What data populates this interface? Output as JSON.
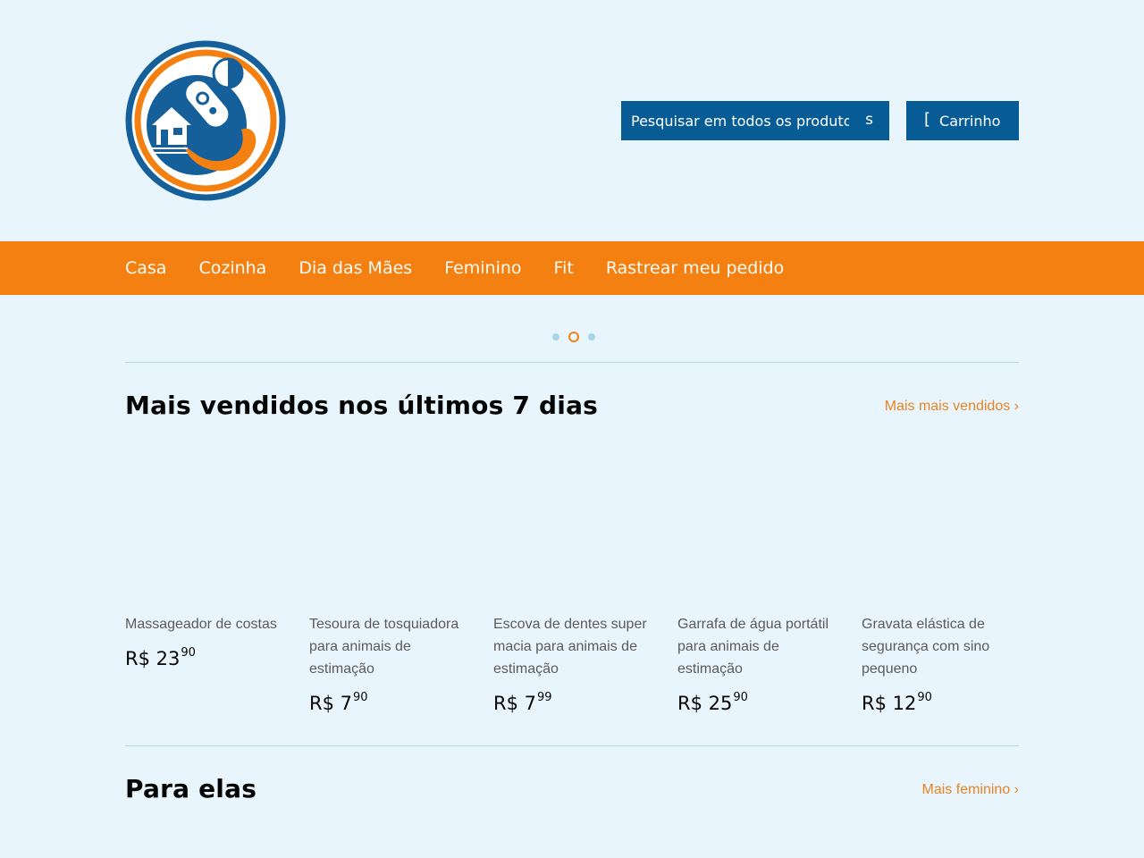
{
  "header": {
    "logo": "rocket-house-logo",
    "search": {
      "placeholder": "Pesquisar em todos os produtos",
      "icon_label": "s"
    },
    "cart": {
      "icon_label": "[",
      "label": "Carrinho"
    }
  },
  "nav": {
    "items": [
      "Casa",
      "Cozinha",
      "Dia das Mães",
      "Feminino",
      "Fit",
      "Rastrear meu pedido"
    ]
  },
  "slideshow": {
    "dots": 3,
    "active_index": 1
  },
  "bestsellers": {
    "title": "Mais vendidos nos últimos 7 dias",
    "link": "Mais mais vendidos ›",
    "products": [
      {
        "name": "Massageador de costas",
        "price": "R$ 23",
        "cents": "90"
      },
      {
        "name": "Tesoura de tosquiadora para animais de estimação",
        "price": "R$ 7",
        "cents": "90"
      },
      {
        "name": "Escova de dentes super macia para animais de estimação",
        "price": "R$ 7",
        "cents": "99"
      },
      {
        "name": "Garrafa de água portátil para animais de estimação",
        "price": "R$ 25",
        "cents": "90"
      },
      {
        "name": "Gravata elástica de segurança com sino pequeno",
        "price": "R$ 12",
        "cents": "90"
      }
    ]
  },
  "for_her": {
    "title": "Para elas",
    "link": "Mais feminino ›"
  },
  "colors": {
    "primary": "#075c96",
    "accent": "#f48011",
    "background": "#e9f5fd"
  }
}
